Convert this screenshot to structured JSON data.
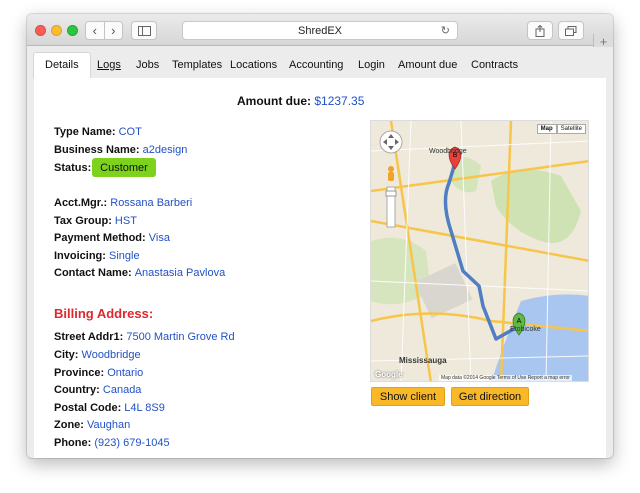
{
  "browser": {
    "title": "ShredEX",
    "nav_back": "‹",
    "nav_forward": "›",
    "reload": "↻",
    "plus": "+"
  },
  "tabs": [
    {
      "label": "Details"
    },
    {
      "label": "Logs"
    },
    {
      "label": "Jobs"
    },
    {
      "label": "Templates"
    },
    {
      "label": "Locations"
    },
    {
      "label": "Accounting"
    },
    {
      "label": "Login"
    },
    {
      "label": "Amount due"
    },
    {
      "label": "Contracts"
    }
  ],
  "amount_due": {
    "label": "Amount due:",
    "value": "$1237.35"
  },
  "client": {
    "type_name": {
      "label": "Type Name:",
      "value": "COT"
    },
    "business_name": {
      "label": "Business Name:",
      "value": "a2design"
    },
    "status": {
      "label": "Status:",
      "value": "Customer"
    },
    "acct_mgr": {
      "label": "Acct.Mgr.:",
      "value": "Rossana Barberi"
    },
    "tax_group": {
      "label": "Tax Group:",
      "value": "HST"
    },
    "payment_method": {
      "label": "Payment Method:",
      "value": "Visa"
    },
    "invoicing": {
      "label": "Invoicing:",
      "value": "Single"
    },
    "contact_name": {
      "label": "Contact Name:",
      "value": "Anastasia Pavlova"
    }
  },
  "billing": {
    "title": "Billing Address:",
    "street": {
      "label": "Street Addr1:",
      "value": "7500 Martin Grove Rd"
    },
    "city": {
      "label": "City:",
      "value": "Woodbridge"
    },
    "province": {
      "label": "Province:",
      "value": "Ontario"
    },
    "country": {
      "label": "Country:",
      "value": "Canada"
    },
    "postal_code": {
      "label": "Postal Code:",
      "value": "L4L 8S9"
    },
    "zone": {
      "label": "Zone:",
      "value": "Vaughan"
    },
    "phone": {
      "label": "Phone:",
      "value": "(923) 679-1045"
    }
  },
  "map": {
    "type_map": "Map",
    "type_satellite": "Satellite",
    "label_woodbridge": "Woodbridge",
    "label_etobicoke": "Etobicoke",
    "label_mississauga": "Mississauga",
    "marker_a": "A",
    "marker_b": "B",
    "logo": "Google",
    "attribution": "Map data ©2014 Google   Terms of Use   Report a map error"
  },
  "buttons": {
    "show_client": "Show client",
    "get_direction": "Get direction"
  },
  "colors": {
    "link": "#2152c4",
    "billing_title": "#e0262e",
    "status_badge": "#7cd21c",
    "action_button": "#f8b828"
  }
}
